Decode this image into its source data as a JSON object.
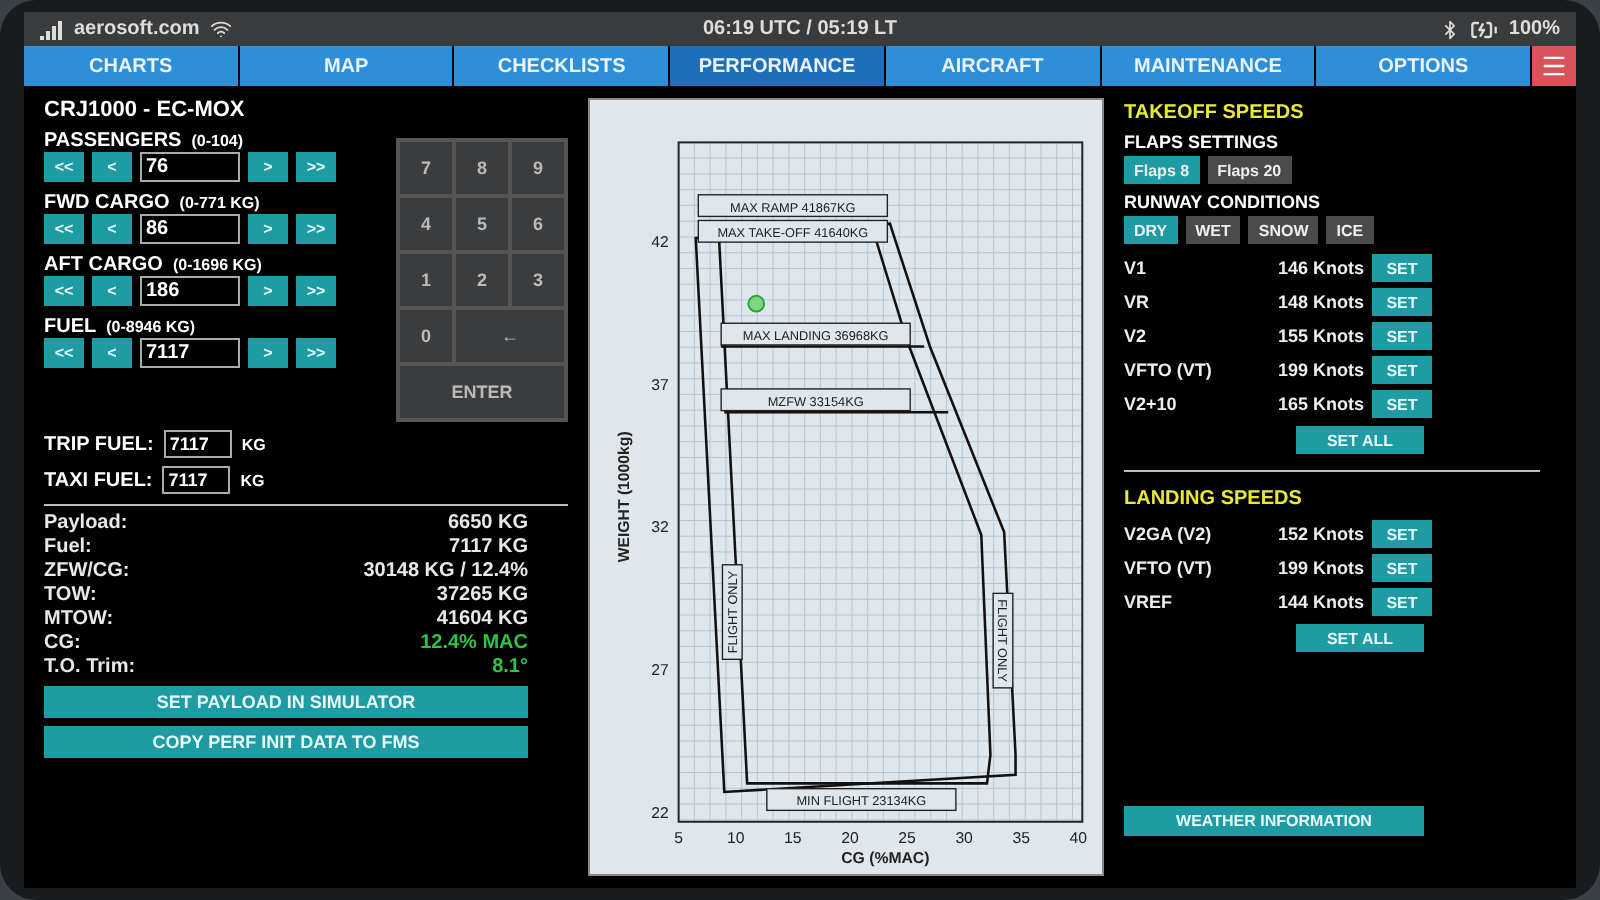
{
  "status_bar": {
    "site": "aerosoft.com",
    "time": "06:19 UTC / 05:19 LT",
    "battery": "100%"
  },
  "tabs": [
    {
      "label": "CHARTS",
      "selected": false
    },
    {
      "label": "MAP",
      "selected": false
    },
    {
      "label": "CHECKLISTS",
      "selected": false
    },
    {
      "label": "PERFORMANCE",
      "selected": true
    },
    {
      "label": "AIRCRAFT",
      "selected": false
    },
    {
      "label": "MAINTENANCE",
      "selected": false
    },
    {
      "label": "OPTIONS",
      "selected": false
    }
  ],
  "aircraft": "CRJ1000 - EC-MOX",
  "load_items": [
    {
      "label": "PASSENGERS",
      "range": "(0-104)",
      "value": "76",
      "decrease": [
        "<<",
        "<"
      ],
      "increase": [
        ">",
        ">>"
      ]
    },
    {
      "label": "FWD CARGO",
      "range": "(0-771 KG)",
      "value": "86",
      "decrease": [
        "<<",
        "<"
      ],
      "increase": [
        ">",
        ">>"
      ]
    },
    {
      "label": "AFT CARGO",
      "range": "(0-1696 KG)",
      "value": "186",
      "decrease": [
        "<<",
        "<"
      ],
      "increase": [
        ">",
        ">>"
      ]
    },
    {
      "label": "FUEL",
      "range": "(0-8946 KG)",
      "value": "7117",
      "decrease": [
        "<<",
        "<"
      ],
      "increase": [
        ">",
        ">>"
      ]
    }
  ],
  "keypad": {
    "keys": [
      "7",
      "8",
      "9",
      "4",
      "5",
      "6",
      "1",
      "2",
      "3",
      "0",
      "←"
    ],
    "enter": "ENTER"
  },
  "fuel_fields": [
    {
      "label": "TRIP FUEL:",
      "value": "7117",
      "unit": "KG"
    },
    {
      "label": "TAXI FUEL:",
      "value": "7117",
      "unit": "KG"
    }
  ],
  "summary": [
    {
      "label": "Payload:",
      "value": "6650 KG",
      "highlight": false
    },
    {
      "label": "Fuel:",
      "value": "7117 KG",
      "highlight": false
    },
    {
      "label": "ZFW/CG:",
      "value": "30148 KG / 12.4%",
      "highlight": false
    },
    {
      "label": "TOW:",
      "value": "37265 KG",
      "highlight": false
    },
    {
      "label": "MTOW:",
      "value": "41604 KG",
      "highlight": false
    },
    {
      "label": "CG:",
      "value": "12.4% MAC",
      "highlight": true
    },
    {
      "label": "T.O. Trim:",
      "value": "8.1°",
      "highlight": true
    }
  ],
  "actions": [
    "SET PAYLOAD IN SIMULATOR",
    "COPY PERF INIT DATA TO FMS"
  ],
  "envelope": {
    "ylabel": "WEIGHT (1000kg)",
    "xlabel": "CG (%MAC)",
    "yticks": [
      "42",
      "37",
      "32",
      "27",
      "22"
    ],
    "xticks": [
      "5",
      "10",
      "15",
      "20",
      "25",
      "30",
      "35",
      "40"
    ],
    "limits": [
      "MAX RAMP 41867KG",
      "MAX TAKE-OFF 41640KG",
      "MAX LANDING 36968KG",
      "MZFW 33154KG",
      "MIN FLIGHT 23134KG"
    ],
    "side_labels": [
      "FLIGHT ONLY",
      "FLIGHT ONLY"
    ]
  },
  "takeoff": {
    "title": "TAKEOFF SPEEDS",
    "flaps_title": "FLAPS SETTINGS",
    "flaps": [
      {
        "label": "Flaps 8",
        "selected": true
      },
      {
        "label": "Flaps 20",
        "selected": false
      }
    ],
    "runway_title": "RUNWAY CONDITIONS",
    "runway": [
      {
        "label": "DRY",
        "selected": true
      },
      {
        "label": "WET",
        "selected": false
      },
      {
        "label": "SNOW",
        "selected": false
      },
      {
        "label": "ICE",
        "selected": false
      }
    ],
    "speeds": [
      {
        "name": "V1",
        "value": "146 Knots",
        "button": "SET"
      },
      {
        "name": "VR",
        "value": "148 Knots",
        "button": "SET"
      },
      {
        "name": "V2",
        "value": "155 Knots",
        "button": "SET"
      },
      {
        "name": "VFTO (VT)",
        "value": "199 Knots",
        "button": "SET"
      },
      {
        "name": "V2+10",
        "value": "165 Knots",
        "button": "SET"
      }
    ],
    "set_all": "SET ALL"
  },
  "landing": {
    "title": "LANDING SPEEDS",
    "speeds": [
      {
        "name": "V2GA (V2)",
        "value": "152 Knots",
        "button": "SET"
      },
      {
        "name": "VFTO (VT)",
        "value": "199 Knots",
        "button": "SET"
      },
      {
        "name": "VREF",
        "value": "144 Knots",
        "button": "SET"
      }
    ],
    "set_all": "SET ALL"
  },
  "weather_button": "WEATHER INFORMATION"
}
